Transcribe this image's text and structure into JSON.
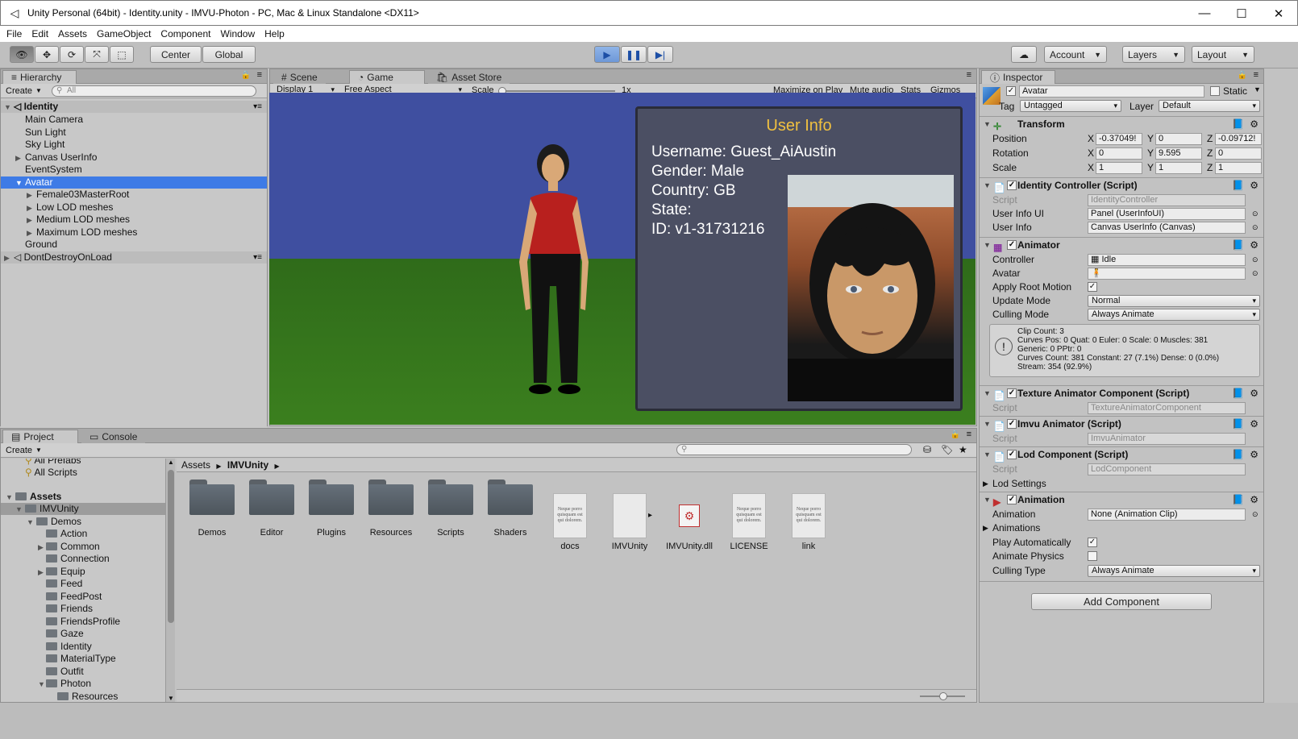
{
  "window": {
    "title": "Unity Personal (64bit) - Identity.unity - IMVU-Photon - PC, Mac & Linux Standalone <DX11>",
    "minimize": "—",
    "maximize": "☐",
    "close": "✕"
  },
  "menu": [
    "File",
    "Edit",
    "Assets",
    "GameObject",
    "Component",
    "Window",
    "Help"
  ],
  "toolbar": {
    "center": "Center",
    "global": "Global",
    "account": "Account",
    "layers": "Layers",
    "layout": "Layout"
  },
  "hierarchy": {
    "tab": "Hierarchy",
    "create": "Create",
    "search_placeholder": "All",
    "scene": "Identity",
    "items": [
      "Main Camera",
      "Sun Light",
      "Sky Light",
      "Canvas UserInfo",
      "EventSystem",
      "Avatar",
      "Female03MasterRoot",
      "Low LOD meshes",
      "Medium LOD meshes",
      "Maximum LOD meshes",
      "Ground"
    ],
    "ddol": "DontDestroyOnLoad"
  },
  "gametabs": {
    "scene": "Scene",
    "game": "Game",
    "store": "Asset Store",
    "display": "Display 1",
    "aspect": "Free Aspect",
    "scale_label": "Scale",
    "scale_value": "1x",
    "maximize": "Maximize on Play",
    "mute": "Mute audio",
    "stats": "Stats",
    "gizmos": "Gizmos"
  },
  "userinfo": {
    "title": "User Info",
    "username": "Username: Guest_AiAustin",
    "gender": "Gender: Male",
    "country": "Country: GB",
    "state": "State:",
    "id": "ID: v1-31731216"
  },
  "inspector": {
    "tab": "Inspector",
    "name": "Avatar",
    "static": "Static",
    "tag_label": "Tag",
    "tag": "Untagged",
    "layer_label": "Layer",
    "layer": "Default",
    "transform": "Transform",
    "position": "Position",
    "rotation": "Rotation",
    "scale": "Scale",
    "pos": [
      "-0.37049!",
      "0",
      "-0.09712!"
    ],
    "rot": [
      "0",
      "9.595",
      "0"
    ],
    "scl": [
      "1",
      "1",
      "1"
    ],
    "x": "X",
    "y": "Y",
    "z": "Z",
    "identity": "Identity Controller (Script)",
    "script": "Script",
    "identity_script": "IdentityController",
    "userinfo_ui_label": "User Info UI",
    "userinfo_ui": "Panel (UserInfoUI)",
    "userinfo_label": "User Info",
    "userinfo": "Canvas UserInfo (Canvas)",
    "animator": "Animator",
    "controller_label": "Controller",
    "controller": "Idle",
    "avatar_label": "Avatar",
    "apply_root": "Apply Root Motion",
    "update_mode_label": "Update Mode",
    "update_mode": "Normal",
    "culling_mode_label": "Culling Mode",
    "culling_mode": "Always Animate",
    "info": [
      "Clip Count: 3",
      "Curves Pos: 0 Quat: 0 Euler: 0 Scale: 0 Muscles: 381",
      "Generic: 0 PPtr: 0",
      "Curves Count: 381 Constant: 27 (7.1%) Dense: 0 (0.0%)",
      "Stream: 354 (92.9%)"
    ],
    "texanim": "Texture Animator Component (Script)",
    "texanim_script": "TextureAnimatorComponent",
    "imvu": "Imvu Animator (Script)",
    "imvu_script": "ImvuAnimator",
    "lod": "Lod Component (Script)",
    "lod_script": "LodComponent",
    "lod_settings": "Lod Settings",
    "animation": "Animation",
    "animation_label": "Animation",
    "animation_clip": "None (Animation Clip)",
    "animations": "Animations",
    "play_auto": "Play Automatically",
    "animate_physics": "Animate Physics",
    "culling_type_label": "Culling Type",
    "culling_type": "Always Animate",
    "add_component": "Add Component"
  },
  "project": {
    "tab": "Project",
    "console": "Console",
    "create": "Create",
    "favs": [
      "All Prefabs",
      "All Scripts"
    ],
    "assets": "Assets",
    "tree": [
      "IMVUnity",
      "Demos",
      "Action",
      "Common",
      "Connection",
      "Equip",
      "Feed",
      "FeedPost",
      "Friends",
      "FriendsProfile",
      "Gaze",
      "Identity",
      "MaterialType",
      "Outfit",
      "Photon",
      "Resources"
    ],
    "breadcrumb": [
      "Assets",
      "IMVUnity"
    ],
    "files": [
      "Demos",
      "Editor",
      "Plugins",
      "Resources",
      "Scripts",
      "Shaders",
      "docs",
      "IMVUnity",
      "IMVUnity.dll",
      "LICENSE",
      "link"
    ],
    "doc_text": "Neque porro quisquam est qui dolorem."
  }
}
